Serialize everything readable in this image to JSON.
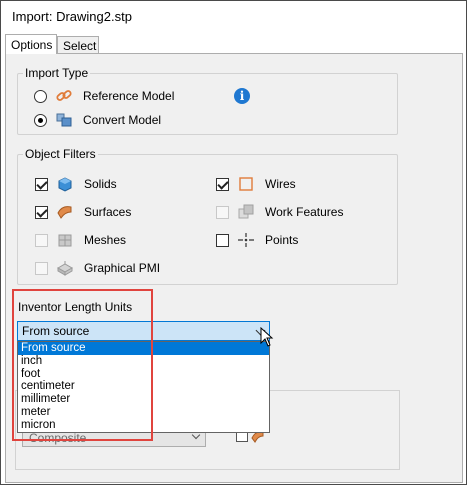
{
  "window": {
    "title": "Import:  Drawing2.stp"
  },
  "tabs": [
    {
      "label": "Options"
    },
    {
      "label": "Select"
    }
  ],
  "import_type": {
    "title": "Import Type",
    "options": [
      {
        "label": "Reference Model",
        "selected": false,
        "icon": "link-icon"
      },
      {
        "label": "Convert Model",
        "selected": true,
        "icon": "convert-model-icon"
      }
    ],
    "info_icon": "i"
  },
  "object_filters": {
    "title": "Object Filters",
    "items": [
      {
        "label": "Solids",
        "checked": true,
        "enabled": true,
        "icon": "solids-icon"
      },
      {
        "label": "Surfaces",
        "checked": true,
        "enabled": true,
        "icon": "surfaces-icon"
      },
      {
        "label": "Meshes",
        "checked": false,
        "enabled": false,
        "icon": "meshes-icon"
      },
      {
        "label": "Graphical PMI",
        "checked": false,
        "enabled": false,
        "icon": "graphical-pmi-icon"
      },
      {
        "label": "Wires",
        "checked": true,
        "enabled": true,
        "icon": "wires-icon"
      },
      {
        "label": "Work Features",
        "checked": false,
        "enabled": false,
        "icon": "work-features-icon"
      },
      {
        "label": "Points",
        "checked": false,
        "enabled": true,
        "icon": "points-icon"
      }
    ]
  },
  "units": {
    "label": "Inventor Length Units",
    "selected": "From source",
    "options": [
      "From source",
      "inch",
      "foot",
      "centimeter",
      "millimeter",
      "meter",
      "micron"
    ]
  },
  "bottom": {
    "combo_value": "Composite"
  },
  "colors": {
    "accent": "#0078d7",
    "highlight": "#e0443e",
    "info": "#1f78d1"
  }
}
